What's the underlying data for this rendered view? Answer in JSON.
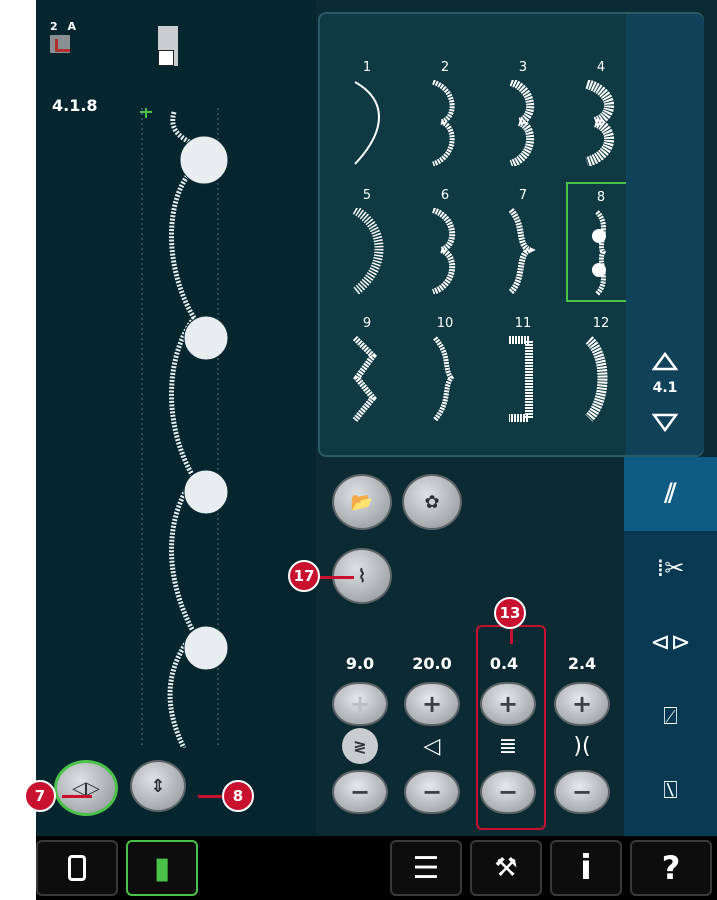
{
  "status": {
    "foot_code": "2 A",
    "stitch_number": "4.1.8"
  },
  "stitch_grid": {
    "numbers": [
      "1",
      "2",
      "3",
      "4",
      "5",
      "6",
      "7",
      "8",
      "9",
      "10",
      "11",
      "12"
    ],
    "selected": "8",
    "page_label": "4.1"
  },
  "params": {
    "width": "9.0",
    "position": "20.0",
    "length": "0.4",
    "density": "2.4"
  },
  "callouts": {
    "c7": "7",
    "c8": "8",
    "c13": "13",
    "c17": "17"
  },
  "bottom_bar": {
    "help": "?",
    "info": "i"
  },
  "colors": {
    "accent_red": "#c8112e",
    "select_green": "#4ac24a"
  }
}
